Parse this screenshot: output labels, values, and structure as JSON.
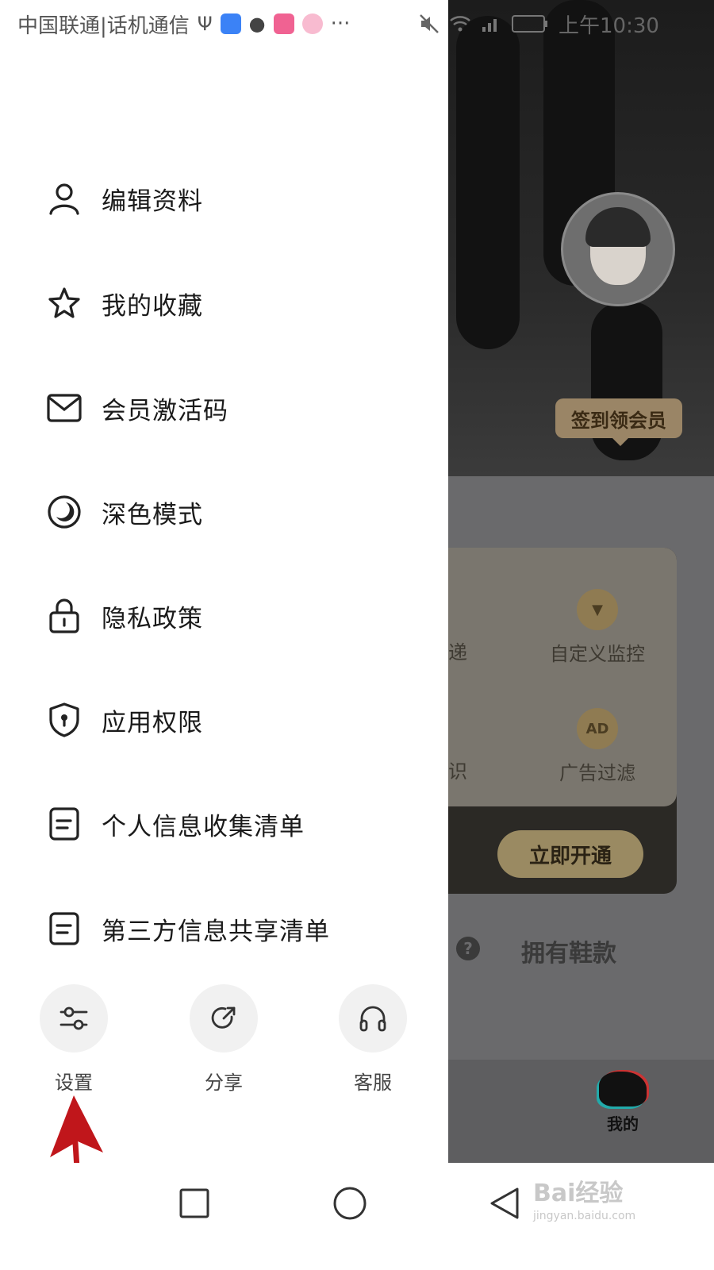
{
  "status_bar": {
    "carrier": "中国联通|话机通信",
    "more": "···",
    "time": "上午10:30"
  },
  "drawer": {
    "menu": [
      {
        "label": "编辑资料",
        "icon": "user-icon"
      },
      {
        "label": "我的收藏",
        "icon": "star-icon"
      },
      {
        "label": "会员激活码",
        "icon": "mail-icon"
      },
      {
        "label": "深色模式",
        "icon": "moon-icon"
      },
      {
        "label": "隐私政策",
        "icon": "lock-icon"
      },
      {
        "label": "应用权限",
        "icon": "shield-icon"
      },
      {
        "label": "个人信息收集清单",
        "icon": "document-icon"
      },
      {
        "label": "第三方信息共享清单",
        "icon": "document-icon"
      }
    ],
    "quick_actions": [
      {
        "label": "设置",
        "icon": "settings-sliders-icon"
      },
      {
        "label": "分享",
        "icon": "share-icon"
      },
      {
        "label": "客服",
        "icon": "headphones-icon"
      }
    ]
  },
  "background_page": {
    "checkin_label": "签到领会员",
    "features": [
      "自定义监控",
      "广告过滤"
    ],
    "partial_features": [
      "递",
      "识"
    ],
    "ad_badge": "AD",
    "open_button": "立即开通",
    "shoes_label": "拥有鞋款",
    "help_glyph": "?",
    "tab_mine": "我的"
  },
  "watermark": {
    "text": "Bai经验",
    "sub": "jingyan.baidu.com"
  },
  "colors": {
    "drawer_bg": "#ffffff",
    "overlay": "#6a6a6c",
    "annotation_arrow": "#c0161b",
    "vip_gold": "#9a8566"
  }
}
